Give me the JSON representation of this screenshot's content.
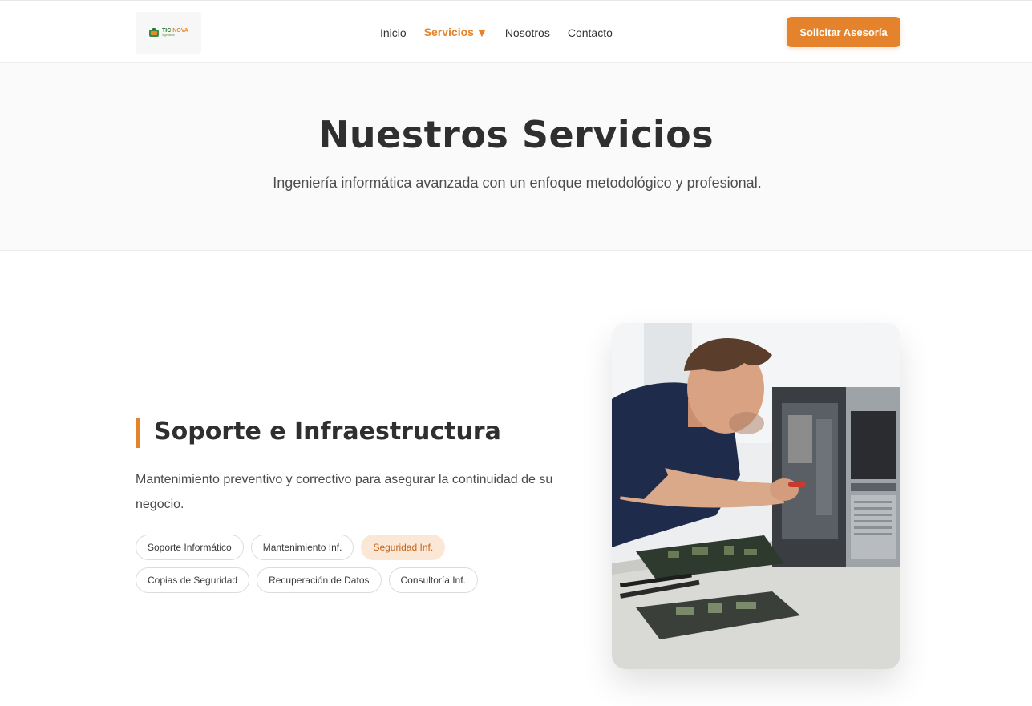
{
  "brand": {
    "name_part1": "TIC",
    "name_part2": "NOVA",
    "tagline": "Ingeniería",
    "accent_color": "#e4832b"
  },
  "nav": {
    "items": [
      {
        "label": "Inicio",
        "active": false
      },
      {
        "label": "Servicios",
        "active": true,
        "has_dropdown": true,
        "caret": "▼"
      },
      {
        "label": "Nosotros",
        "active": false
      },
      {
        "label": "Contacto",
        "active": false
      }
    ]
  },
  "header": {
    "cta_label": "Solicitar Asesoría"
  },
  "hero": {
    "title": "Nuestros Servicios",
    "subtitle": "Ingeniería informática avanzada con un enfoque metodológico y profesional."
  },
  "service": {
    "title": "Soporte e Infraestructura",
    "description": "Mantenimiento preventivo y correctivo para asegurar la continuidad de su negocio.",
    "tags_row1": [
      {
        "label": "Soporte Informático",
        "active": false
      },
      {
        "label": "Mantenimiento Inf.",
        "active": false
      },
      {
        "label": "Seguridad Inf.",
        "active": true
      }
    ],
    "tags_row2": [
      {
        "label": "Copias de Seguridad",
        "active": false
      },
      {
        "label": "Recuperación de Datos",
        "active": false
      },
      {
        "label": "Consultoría Inf.",
        "active": false
      }
    ],
    "image_subject": "technician-repairing-desktop-computer"
  }
}
